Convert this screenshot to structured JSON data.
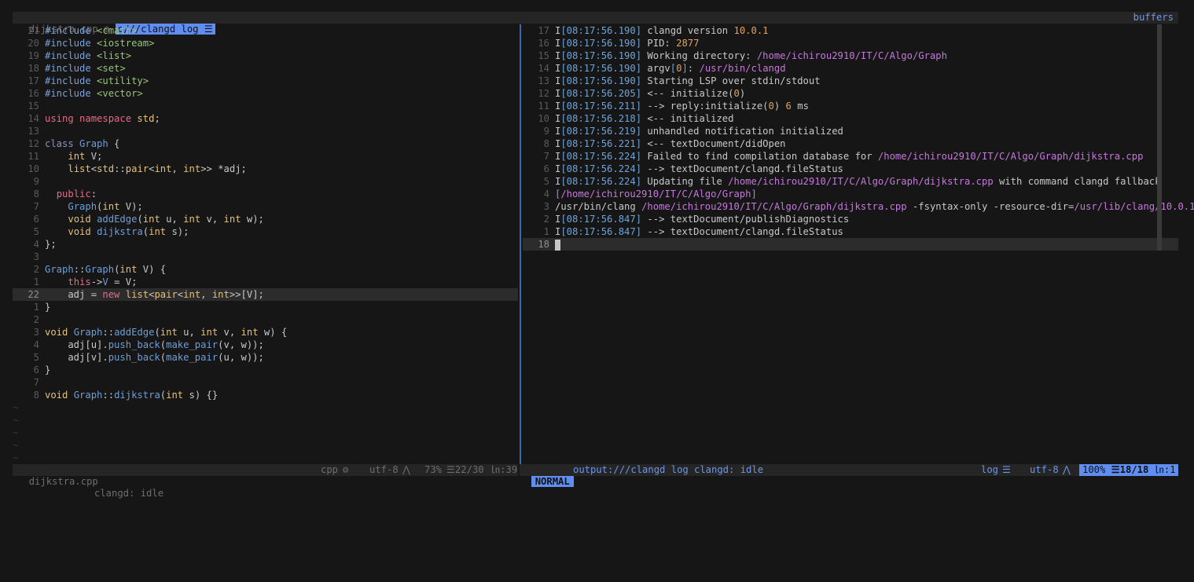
{
  "tabline": {
    "inactive_tab": "dijkstra.cpp",
    "inactive_icon": "⚙",
    "active_tab": "o///clangd log",
    "active_icon": "☰",
    "buffers": "buffers"
  },
  "left_editor": {
    "lines": [
      {
        "num": "21",
        "html": "<span class='pp'>#include</span> <span class='inc'>&lt;cmath&gt;</span>"
      },
      {
        "num": "20",
        "html": "<span class='pp'>#include</span> <span class='inc'>&lt;iostream&gt;</span>"
      },
      {
        "num": "19",
        "html": "<span class='pp'>#include</span> <span class='inc'>&lt;list&gt;</span>"
      },
      {
        "num": "18",
        "html": "<span class='pp'>#include</span> <span class='inc'>&lt;set&gt;</span>"
      },
      {
        "num": "17",
        "html": "<span class='pp'>#include</span> <span class='inc'>&lt;utility&gt;</span>"
      },
      {
        "num": "16",
        "html": "<span class='pp'>#include</span> <span class='inc'>&lt;vector&gt;</span>"
      },
      {
        "num": "15",
        "html": ""
      },
      {
        "num": "14",
        "html": "<span class='red'>using</span> <span class='red'>namespace</span> <span class='ty'>std</span>;"
      },
      {
        "num": "13",
        "html": ""
      },
      {
        "num": "12",
        "html": "<span class='kw'>class</span> <span class='fn'>Graph</span> {"
      },
      {
        "num": "11",
        "html": "    <span class='ty'>int</span> V;"
      },
      {
        "num": "10",
        "html": "    <span class='ty'>list</span>&lt;<span class='ty'>std</span>::<span class='ty'>pair</span>&lt;<span class='ty'>int</span>, <span class='ty'>int</span>&gt;&gt; *adj;"
      },
      {
        "num": "9",
        "html": ""
      },
      {
        "num": "8",
        "html": "  <span class='red'>public</span>:"
      },
      {
        "num": "7",
        "html": "    <span class='fn'>Graph</span>(<span class='ty'>int</span> V);"
      },
      {
        "num": "6",
        "html": "    <span class='ty'>void</span> <span class='fn'>addEdge</span>(<span class='ty'>int</span> u, <span class='ty'>int</span> v, <span class='ty'>int</span> w);"
      },
      {
        "num": "5",
        "html": "    <span class='ty'>void</span> <span class='fn'>dijkstra</span>(<span class='ty'>int</span> s);"
      },
      {
        "num": "4",
        "html": "};"
      },
      {
        "num": "3",
        "html": ""
      },
      {
        "num": "2",
        "html": "<span class='fn'>Graph</span>::<span class='fn'>Graph</span>(<span class='ty'>int</span> V) {"
      },
      {
        "num": "1",
        "html": "    <span class='red'>this</span>-&gt;<span class='fn'>V</span> = V;"
      },
      {
        "num": "22",
        "html": "    adj = <span class='red'>new</span> <span class='ty'>list</span>&lt;<span class='ty'>pair</span>&lt;<span class='ty'>int</span>, <span class='ty'>int</span>&gt;&gt;[V];",
        "current": true
      },
      {
        "num": "1",
        "html": "}"
      },
      {
        "num": "2",
        "html": ""
      },
      {
        "num": "3",
        "html": "<span class='ty'>void</span> <span class='fn'>Graph</span>::<span class='fn'>addEdge</span>(<span class='ty'>int</span> u, <span class='ty'>int</span> v, <span class='ty'>int</span> w) {"
      },
      {
        "num": "4",
        "html": "    adj[u].<span class='fn'>push_back</span>(<span class='fn'>make_pair</span>(v, w));"
      },
      {
        "num": "5",
        "html": "    adj[v].<span class='fn'>push_back</span>(<span class='fn'>make_pair</span>(u, w));"
      },
      {
        "num": "6",
        "html": "}"
      },
      {
        "num": "7",
        "html": ""
      },
      {
        "num": "8",
        "html": "<span class='ty'>void</span> <span class='fn'>Graph</span>::<span class='fn'>dijkstra</span>(<span class='ty'>int</span> s) {}"
      }
    ],
    "tilde_count": 5
  },
  "right_log": {
    "lines": [
      {
        "num": "17",
        "html": "I<span class='ts'>[08:17:56.190]</span> clangd version <span class='num'>10.0.1</span>"
      },
      {
        "num": "16",
        "html": "I<span class='ts'>[08:17:56.190]</span> PID: <span class='num'>2877</span>"
      },
      {
        "num": "15",
        "html": "I<span class='ts'>[08:17:56.190]</span> Working directory: <span class='path'>/home/ichirou2910/IT/C/Algo/Graph</span>"
      },
      {
        "num": "14",
        "html": "I<span class='ts'>[08:17:56.190]</span> argv<span class='ts'>[</span><span class='num'>0</span><span class='ts'>]</span>: <span class='path'>/usr/bin/clangd</span>"
      },
      {
        "num": "13",
        "html": "I<span class='ts'>[08:17:56.190]</span> Starting LSP over stdin/stdout"
      },
      {
        "num": "12",
        "html": "I<span class='ts'>[08:17:56.205]</span> &lt;-- initialize(<span class='num'>0</span>)"
      },
      {
        "num": "11",
        "html": "I<span class='ts'>[08:17:56.211]</span> --&gt; reply:initialize(<span class='num'>0</span>) <span class='num'>6</span> ms"
      },
      {
        "num": "10",
        "html": "I<span class='ts'>[08:17:56.218]</span> &lt;-- initialized"
      },
      {
        "num": "9",
        "html": "I<span class='ts'>[08:17:56.219]</span> unhandled notification initialized"
      },
      {
        "num": "8",
        "html": "I<span class='ts'>[08:17:56.221]</span> &lt;-- textDocument/didOpen"
      },
      {
        "num": "7",
        "html": "I<span class='ts'>[08:17:56.224]</span> Failed to find compilation database for <span class='path'>/home/ichirou2910/IT/C/Algo/Graph/dijkstra.cpp</span>"
      },
      {
        "num": "6",
        "html": "I<span class='ts'>[08:17:56.224]</span> --&gt; textDocument/clangd.fileStatus"
      },
      {
        "num": "5",
        "html": "I<span class='ts'>[08:17:56.224]</span> Updating file <span class='path'>/home/ichirou2910/IT/C/Algo/Graph/dijkstra.cpp</span> with command clangd fallback"
      },
      {
        "num": "4",
        "html": "<span class='path'>[/home/ichirou2910/IT/C/Algo/Graph]</span>"
      },
      {
        "num": "3",
        "html": "/usr/bin/clang <span class='path'>/home/ichirou2910/IT/C/Algo/Graph/dijkstra.cpp</span> -fsyntax-only -resource-dir=<span class='path'>/usr/lib/clang/10.0.1</span>"
      },
      {
        "num": "2",
        "html": "I<span class='ts'>[08:17:56.847]</span> --&gt; textDocument/publishDiagnostics"
      },
      {
        "num": "1",
        "html": "I<span class='ts'>[08:17:56.847]</span> --&gt; textDocument/clangd.fileStatus"
      },
      {
        "num": "18",
        "html": "<span class='cursor'></span>",
        "current": true
      }
    ]
  },
  "status_left": {
    "filename": "dijkstra.cpp",
    "lsp": "clangd: idle",
    "filetype": "cpp",
    "filetype_icon": "⚙",
    "encoding": "utf-8",
    "os_icon": "⋀",
    "percent": "73%",
    "position": "☰22/30",
    "column": "㏑:39"
  },
  "status_right": {
    "mode": "NORMAL",
    "buffer": "output:///clangd log",
    "lsp": "clangd: idle",
    "filetype": "log",
    "filetype_icon": "☰",
    "encoding": "utf-8",
    "os_icon": "⋀",
    "percent": "100%",
    "position": "☰18/18",
    "column": "㏑:1"
  },
  "colors": {
    "accent": "#5f8df0",
    "background": "#161616",
    "separator": "#3b6aa8"
  }
}
